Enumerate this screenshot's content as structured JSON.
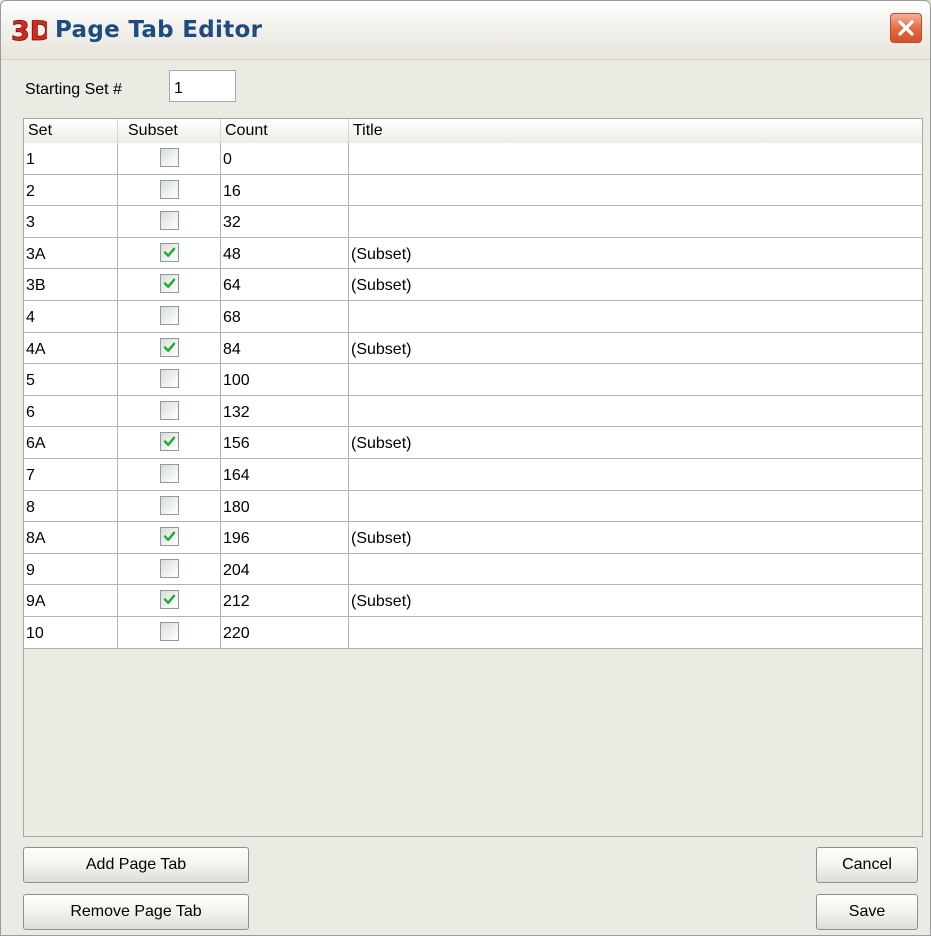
{
  "window": {
    "logo_text": "3D",
    "title": "Page Tab Editor",
    "accent_color": "#D7281F"
  },
  "starting_set": {
    "label": "Starting Set #",
    "value": "1"
  },
  "table": {
    "columns": [
      "Set",
      "Subset",
      "Count",
      "Title"
    ],
    "rows": [
      {
        "set": "1",
        "subset": false,
        "count": "0",
        "title": ""
      },
      {
        "set": "2",
        "subset": false,
        "count": "16",
        "title": ""
      },
      {
        "set": "3",
        "subset": false,
        "count": "32",
        "title": ""
      },
      {
        "set": "3A",
        "subset": true,
        "count": "48",
        "title": "(Subset)"
      },
      {
        "set": "3B",
        "subset": true,
        "count": "64",
        "title": "(Subset)"
      },
      {
        "set": "4",
        "subset": false,
        "count": "68",
        "title": ""
      },
      {
        "set": "4A",
        "subset": true,
        "count": "84",
        "title": "(Subset)"
      },
      {
        "set": "5",
        "subset": false,
        "count": "100",
        "title": ""
      },
      {
        "set": "6",
        "subset": false,
        "count": "132",
        "title": ""
      },
      {
        "set": "6A",
        "subset": true,
        "count": "156",
        "title": "(Subset)"
      },
      {
        "set": "7",
        "subset": false,
        "count": "164",
        "title": ""
      },
      {
        "set": "8",
        "subset": false,
        "count": "180",
        "title": ""
      },
      {
        "set": "8A",
        "subset": true,
        "count": "196",
        "title": "(Subset)"
      },
      {
        "set": "9",
        "subset": false,
        "count": "204",
        "title": ""
      },
      {
        "set": "9A",
        "subset": true,
        "count": "212",
        "title": "(Subset)"
      },
      {
        "set": "10",
        "subset": false,
        "count": "220",
        "title": ""
      }
    ]
  },
  "buttons": {
    "add": "Add Page Tab",
    "remove": "Remove Page Tab",
    "cancel": "Cancel",
    "save": "Save"
  }
}
